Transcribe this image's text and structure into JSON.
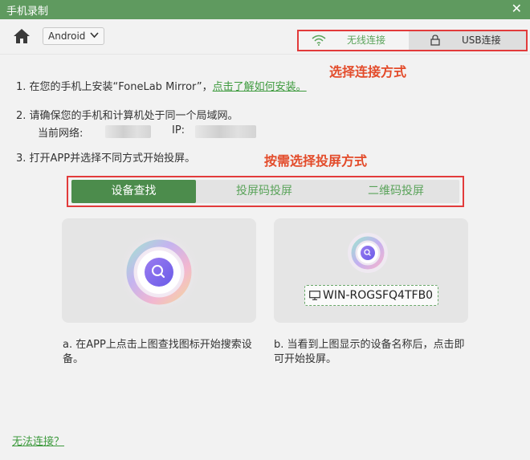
{
  "window": {
    "title": "手机录制",
    "close_glyph": "✕"
  },
  "toolbar": {
    "platform": "Android"
  },
  "connection": {
    "wifi_label": "无线连接",
    "usb_label": "USB连接",
    "selected": "无线连接",
    "accent": "#5aa35a"
  },
  "annotations": {
    "select_connection": "选择连接方式",
    "select_mirror_mode": "按需选择投屏方式"
  },
  "steps": {
    "step1_text": "1. 在您的手机上安装“FoneLab Mirror”，",
    "step1_link": "点击了解如何安装。",
    "step2_text": "2. 请确保您的手机和计算机处于同一个局域网。",
    "network_label": "当前网络:",
    "ip_label": "IP:",
    "step3_text": "3. 打开APP并选择不同方式开始投屏。"
  },
  "modes": {
    "tabs": [
      "设备查找",
      "投屏码投屏",
      "二维码投屏"
    ],
    "active": "设备查找"
  },
  "cards": {
    "device_name": "WIN-ROGSFQ4TFB0",
    "caption_a": "a. 在APP上点击上图查找图标开始搜索设备。",
    "caption_b": "b. 当看到上图显示的设备名称后，点击即可开始投屏。"
  },
  "footer": {
    "cant_connect": "无法连接？"
  },
  "icons": [
    "home-icon",
    "chevron-down-icon",
    "wifi-icon",
    "lock-icon",
    "search-icon",
    "monitor-icon",
    "close-icon"
  ],
  "colors": {
    "titlebar": "#5f9a5f",
    "active_tab": "#4c8c4c",
    "annotation": "#e34b2a",
    "highlight_border": "#e23b3b"
  }
}
